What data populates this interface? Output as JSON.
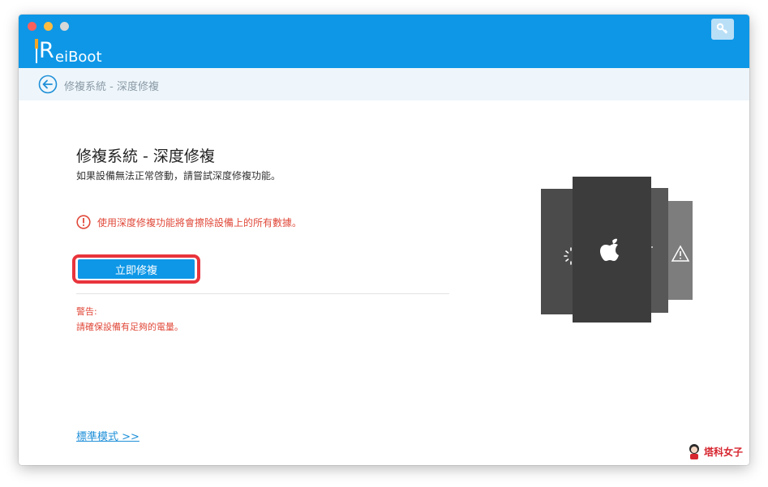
{
  "app": {
    "name": "ReiBoot",
    "logo_letter": "R",
    "logo_rest": "eiBoot"
  },
  "header": {
    "key_icon": "key-icon"
  },
  "breadcrumb": {
    "text": "修複系統 - 深度修複"
  },
  "main": {
    "title": "修複系統 - 深度修複",
    "subtitle": "如果設備無法正常啓動，請嘗試深度修複功能。",
    "warning": "使用深度修複功能將會擦除設備上的所有數據。",
    "fix_button": "立即修複",
    "note_title": "警告:",
    "note_body": "請確保設備有足夠的電量。",
    "standard_mode_link": "標準模式 >>"
  },
  "watermark": {
    "text": "塔科女子"
  },
  "colors": {
    "accent": "#0e97e7",
    "warning": "#e0493a",
    "highlight_border": "#e8343c"
  }
}
